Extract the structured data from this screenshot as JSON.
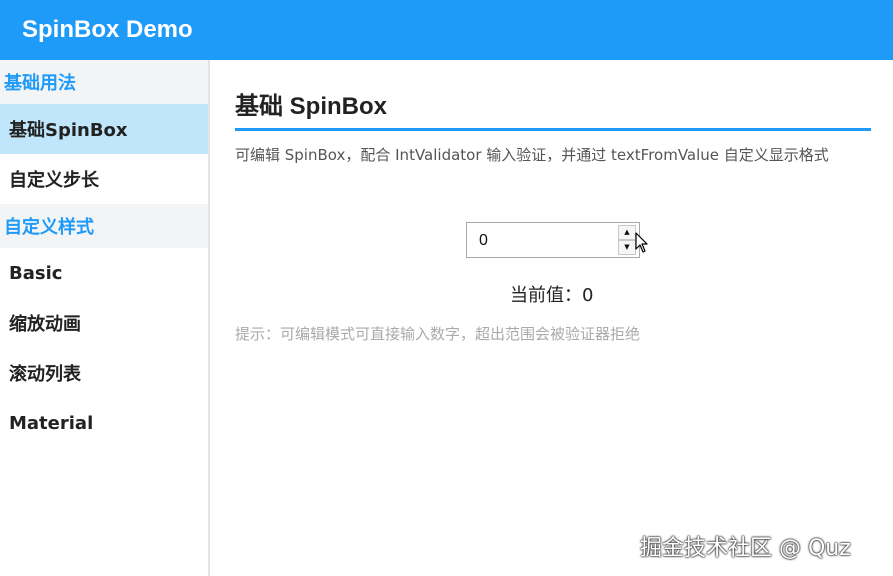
{
  "app": {
    "title": "SpinBox Demo"
  },
  "sidebar": {
    "groups": [
      {
        "label": "基础用法",
        "items": [
          {
            "label": "基础SpinBox",
            "active": true
          },
          {
            "label": "自定义步长",
            "active": false
          }
        ]
      },
      {
        "label": "自定义样式",
        "items": [
          {
            "label": "Basic"
          },
          {
            "label": "缩放动画"
          },
          {
            "label": "滚动列表"
          },
          {
            "label": "Material"
          }
        ]
      }
    ]
  },
  "main": {
    "title": "基础 SpinBox",
    "description": "可编辑 SpinBox，配合 IntValidator 输入验证，并通过 textFromValue 自定义显示格式",
    "spinbox": {
      "value": "0",
      "up_icon": "caret-up-icon",
      "down_icon": "caret-down-icon"
    },
    "current_value_text": "当前值：0",
    "hint": "提示：可编辑模式可直接输入数字，超出范围会被验证器拒绝"
  },
  "watermark": "掘金技术社区 @ Quz",
  "colors": {
    "accent": "#1e9af8",
    "active_item_bg": "#bfe6fb",
    "group_bg": "#f3f4f6"
  }
}
